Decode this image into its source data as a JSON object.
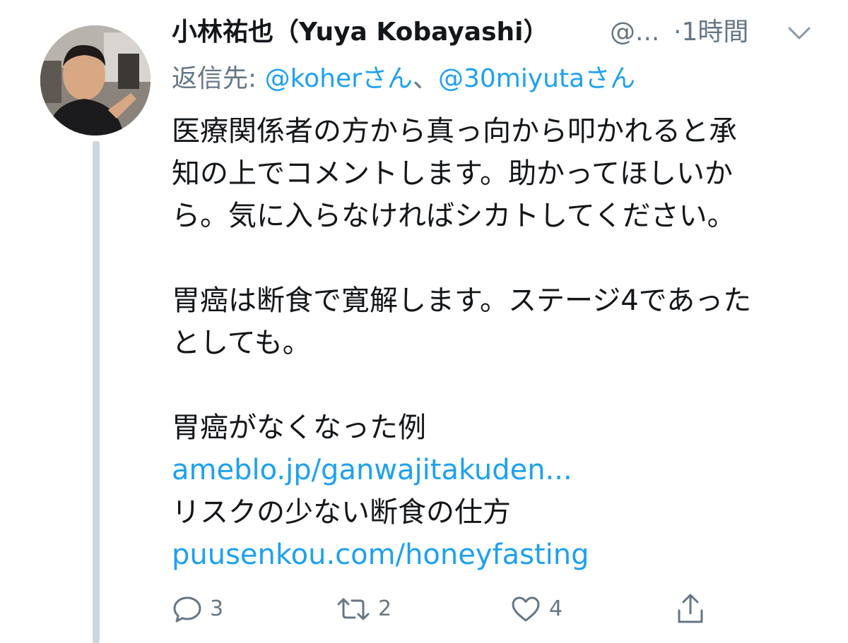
{
  "tweet": {
    "display_name": "小林祐也（Yuya Kobayashi）",
    "handle": "@...",
    "timestamp": "·1時間",
    "reply_to": {
      "prefix": "返信先: ",
      "mention1": "@koherさん",
      "separator": "、",
      "mention2": "@30miyutaさん"
    },
    "body": {
      "line1": "医療関係者の方から真っ向から叩かれると承",
      "line2": "知の上でコメントします。助かってほしいか",
      "line3": "ら。気に入らなければシカトしてください。",
      "line4": "胃癌は断食で寛解します。ステージ4であった",
      "line5": "としても。",
      "line6": "胃癌がなくなった例",
      "link1": "ameblo.jp/ganwajitakuden...",
      "line7": "リスクの少ない断食の仕方",
      "link2": "puusenkou.com/honeyfasting"
    },
    "actions": {
      "reply_count": "3",
      "retweet_count": "2",
      "like_count": "4"
    }
  },
  "colors": {
    "text": "#14171a",
    "secondary": "#657786",
    "link": "#1da1f2",
    "thread_line": "#ccd6dd",
    "background": "#ffffff"
  },
  "icons": {
    "caret": "chevron-down-icon",
    "reply": "reply-icon",
    "retweet": "retweet-icon",
    "like": "heart-icon",
    "share": "share-icon"
  }
}
